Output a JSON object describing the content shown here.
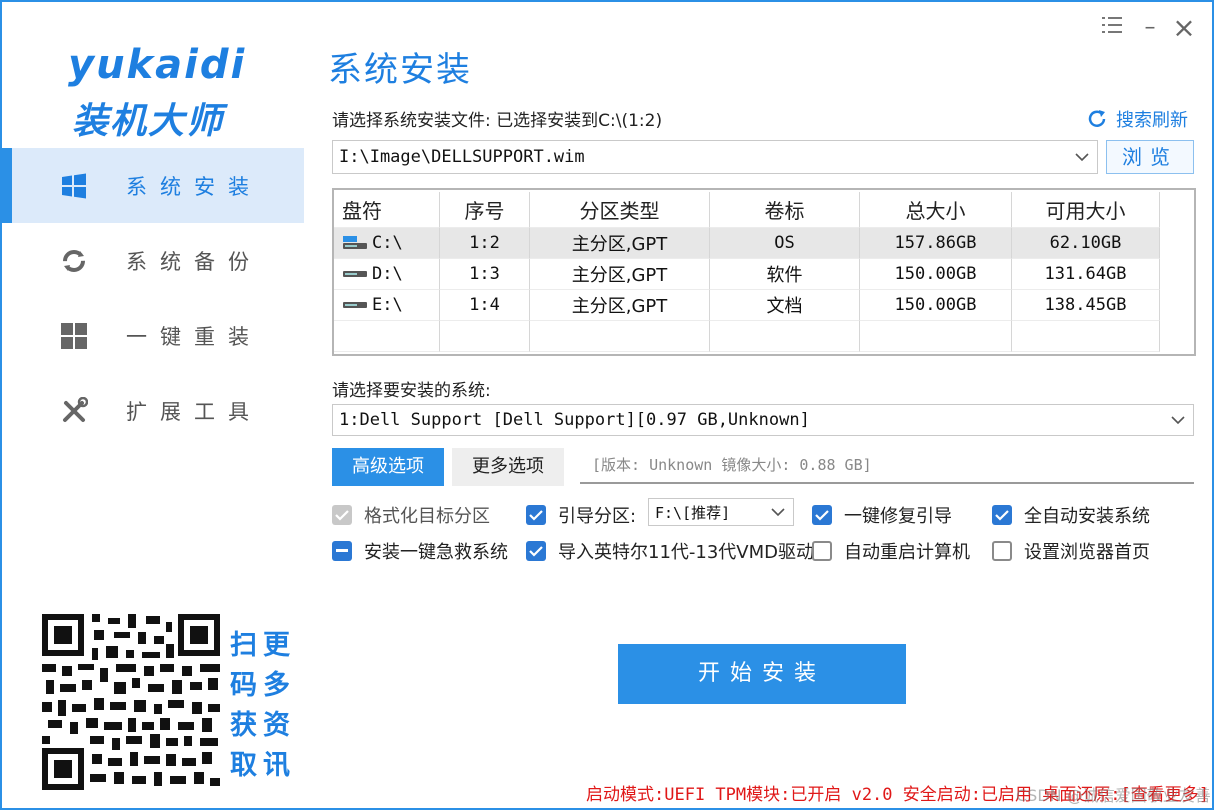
{
  "app": {
    "logo_line1": "yukaidi",
    "logo_line2": "装机大师"
  },
  "window_controls": {
    "menu_icon": "menu-icon",
    "minimize": "–",
    "close": "×"
  },
  "sidebar": {
    "items": [
      {
        "label": "系统安装",
        "icon": "windows-icon",
        "active": true
      },
      {
        "label": "系统备份",
        "icon": "refresh-icon",
        "active": false
      },
      {
        "label": "一键重装",
        "icon": "tiles-icon",
        "active": false
      },
      {
        "label": "扩展工具",
        "icon": "tools-icon",
        "active": false
      }
    ],
    "qr_caption": [
      "扫更",
      "码多",
      "获资",
      "取讯"
    ]
  },
  "main": {
    "title": "系统安装",
    "file_label": "请选择系统安装文件: 已选择安装到C:\\(1:2)",
    "refresh_label": "搜索刷新",
    "file_path": "I:\\Image\\DELLSUPPORT.wim",
    "browse_label": "浏览",
    "table": {
      "headers": [
        "盘符",
        "序号",
        "分区类型",
        "卷标",
        "总大小",
        "可用大小"
      ],
      "rows": [
        {
          "drive": "C:\\",
          "index": "1:2",
          "type": "主分区,GPT",
          "label": "OS",
          "total": "157.86GB",
          "free": "62.10GB",
          "selected": true
        },
        {
          "drive": "D:\\",
          "index": "1:3",
          "type": "主分区,GPT",
          "label": "软件",
          "total": "150.00GB",
          "free": "131.64GB",
          "selected": false
        },
        {
          "drive": "E:\\",
          "index": "1:4",
          "type": "主分区,GPT",
          "label": "文档",
          "total": "150.00GB",
          "free": "138.45GB",
          "selected": false
        }
      ]
    },
    "system_label": "请选择要安装的系统:",
    "system_value": "1:Dell Support [Dell Support][0.97 GB,Unknown]",
    "tabs": {
      "advanced": "高级选项",
      "more": "更多选项"
    },
    "version_text": "[版本: Unknown 镜像大小: 0.88 GB]",
    "options": {
      "format_target": "格式化目标分区",
      "boot_partition": "引导分区:",
      "boot_partition_value": "F:\\[推荐]",
      "repair_boot": "一键修复引导",
      "auto_install": "全自动安装系统",
      "rescue_system": "安装一键急救系统",
      "import_vmd": "导入英特尔11代-13代VMD驱动",
      "auto_restart": "自动重启计算机",
      "set_homepage": "设置浏览器首页"
    },
    "start_button": "开始安装",
    "status_bar": "启动模式:UEFI TPM模块:已开启 v2.0 安全启动:已启用 桌面还原:[查看更多]",
    "watermark": "CSDN @诚信爱国敬业友善"
  },
  "colors": {
    "accent": "#2b90e6",
    "checkbox": "#2b78d4",
    "status_red": "#e01818",
    "active_bg": "#dceafa"
  }
}
